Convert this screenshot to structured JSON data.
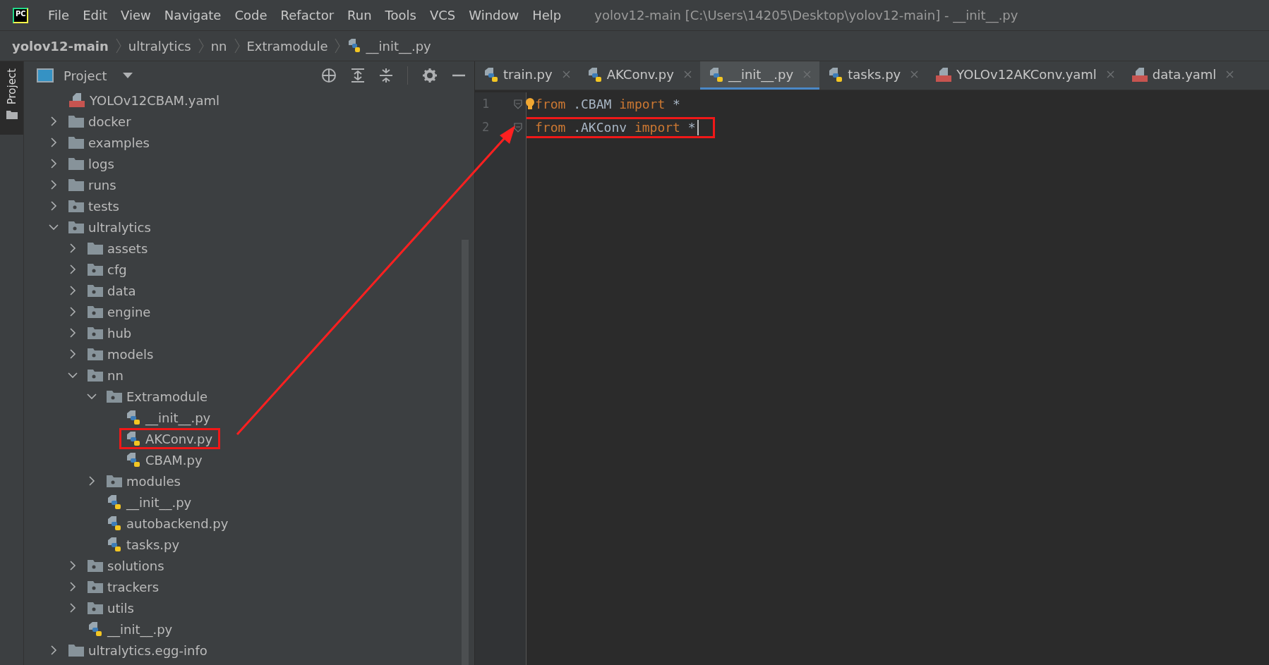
{
  "app_logo": "PC",
  "menu": [
    "File",
    "Edit",
    "View",
    "Navigate",
    "Code",
    "Refactor",
    "Run",
    "Tools",
    "VCS",
    "Window",
    "Help"
  ],
  "window": {
    "title": "yolov12-main [C:\\Users\\14205\\Desktop\\yolov12-main] - __init__.py"
  },
  "breadcrumb": [
    {
      "label": "yolov12-main",
      "kind": "project"
    },
    {
      "label": "ultralytics",
      "kind": "folder"
    },
    {
      "label": "nn",
      "kind": "folder"
    },
    {
      "label": "Extramodule",
      "kind": "folder"
    },
    {
      "label": "__init__.py",
      "kind": "python"
    }
  ],
  "side_stripe": {
    "label": "Project",
    "selected": true
  },
  "project_panel": {
    "title": "Project"
  },
  "tree": [
    {
      "label": "YOLOv12CBAM.yaml",
      "kind": "yaml"
    },
    {
      "label": "docker",
      "kind": "folder",
      "expanded": false
    },
    {
      "label": "examples",
      "kind": "folder",
      "expanded": false
    },
    {
      "label": "logs",
      "kind": "folder",
      "expanded": false
    },
    {
      "label": "runs",
      "kind": "folder",
      "expanded": false
    },
    {
      "label": "tests",
      "kind": "package",
      "expanded": false
    },
    {
      "label": "ultralytics",
      "kind": "package",
      "expanded": true,
      "children": [
        {
          "label": "assets",
          "kind": "folder",
          "expanded": false
        },
        {
          "label": "cfg",
          "kind": "package",
          "expanded": false
        },
        {
          "label": "data",
          "kind": "package",
          "expanded": false
        },
        {
          "label": "engine",
          "kind": "package",
          "expanded": false
        },
        {
          "label": "hub",
          "kind": "package",
          "expanded": false
        },
        {
          "label": "models",
          "kind": "package",
          "expanded": false
        },
        {
          "label": "nn",
          "kind": "package",
          "expanded": true,
          "children": [
            {
              "label": "Extramodule",
              "kind": "package",
              "expanded": true,
              "children": [
                {
                  "label": "__init__.py",
                  "kind": "python",
                  "highlighted": false
                },
                {
                  "label": "AKConv.py",
                  "kind": "python",
                  "highlighted": true
                },
                {
                  "label": "CBAM.py",
                  "kind": "python",
                  "highlighted": false
                }
              ]
            },
            {
              "label": "modules",
              "kind": "package",
              "expanded": false
            },
            {
              "label": "__init__.py",
              "kind": "python"
            },
            {
              "label": "autobackend.py",
              "kind": "python"
            },
            {
              "label": "tasks.py",
              "kind": "python"
            }
          ]
        },
        {
          "label": "solutions",
          "kind": "package",
          "expanded": false
        },
        {
          "label": "trackers",
          "kind": "package",
          "expanded": false
        },
        {
          "label": "utils",
          "kind": "package",
          "expanded": false
        },
        {
          "label": "__init__.py",
          "kind": "python"
        }
      ]
    },
    {
      "label": "ultralytics.egg-info",
      "kind": "folder",
      "expanded": false
    }
  ],
  "tabs": [
    {
      "label": "train.py",
      "kind": "python",
      "selected": false
    },
    {
      "label": "AKConv.py",
      "kind": "python",
      "selected": false
    },
    {
      "label": "__init__.py",
      "kind": "python",
      "selected": true
    },
    {
      "label": "tasks.py",
      "kind": "python",
      "selected": false
    },
    {
      "label": "YOLOv12AKConv.yaml",
      "kind": "yaml",
      "selected": false
    },
    {
      "label": "data.yaml",
      "kind": "yaml",
      "selected": false
    }
  ],
  "code": [
    {
      "number": "1",
      "highlighted": false,
      "caret": false,
      "tokens": [
        {
          "text": "from",
          "kind": "keyword"
        },
        {
          "text": " .CBAM ",
          "kind": "plain"
        },
        {
          "text": "import",
          "kind": "keyword"
        },
        {
          "text": " *",
          "kind": "plain"
        }
      ]
    },
    {
      "number": "2",
      "highlighted": true,
      "caret": true,
      "tokens": [
        {
          "text": "from",
          "kind": "keyword"
        },
        {
          "text": " .AKConv ",
          "kind": "plain"
        },
        {
          "text": "import",
          "kind": "keyword"
        },
        {
          "text": " *",
          "kind": "plain"
        }
      ]
    }
  ]
}
